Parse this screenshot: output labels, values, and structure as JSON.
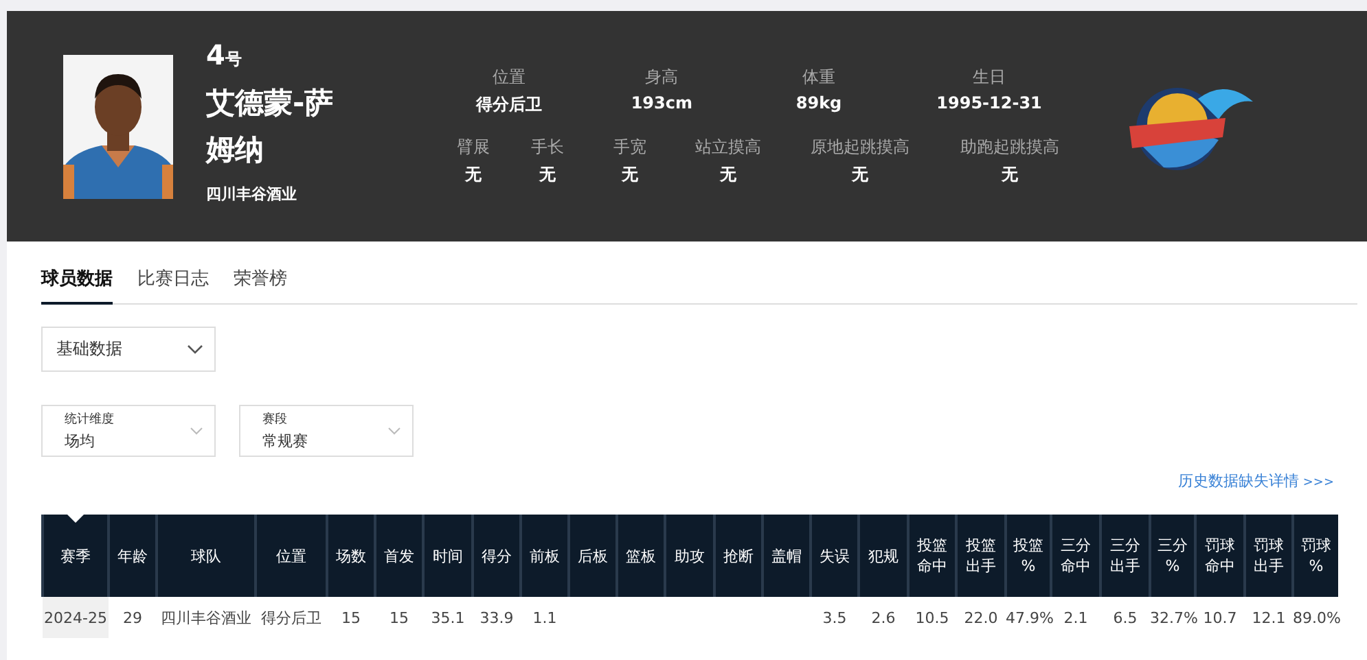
{
  "player": {
    "number": "4",
    "number_suffix": "号",
    "name": "艾德蒙-萨姆纳",
    "team": "四川丰谷酒业"
  },
  "info_rows": [
    [
      {
        "label": "位置",
        "value": "得分后卫"
      },
      {
        "label": "身高",
        "value": "193cm"
      },
      {
        "label": "体重",
        "value": "89kg"
      },
      {
        "label": "生日",
        "value": "1995-12-31"
      }
    ],
    [
      {
        "label": "臂展",
        "value": "无"
      },
      {
        "label": "手长",
        "value": "无"
      },
      {
        "label": "手宽",
        "value": "无"
      },
      {
        "label": "站立摸高",
        "value": "无"
      },
      {
        "label": "原地起跳摸高",
        "value": "无"
      },
      {
        "label": "助跑起跳摸高",
        "value": "无"
      }
    ]
  ],
  "tabs": [
    {
      "label": "球员数据",
      "selected": true
    },
    {
      "label": "比赛日志",
      "selected": false
    },
    {
      "label": "荣誉榜",
      "selected": false
    }
  ],
  "data_type_select": {
    "value": "基础数据"
  },
  "filters": [
    {
      "label": "统计维度",
      "value": "场均"
    },
    {
      "label": "赛段",
      "value": "常规赛"
    }
  ],
  "history_link": {
    "text": "历史数据缺失详情",
    "arrows": ">>>"
  },
  "table": {
    "columns": [
      {
        "label": "赛季",
        "sorted": true
      },
      {
        "label": "年龄",
        "sorted": false
      },
      {
        "label": "球队",
        "sorted": false
      },
      {
        "label": "位置",
        "sorted": false
      },
      {
        "label": "场数",
        "sorted": false
      },
      {
        "label": "首发",
        "sorted": false
      },
      {
        "label": "时间",
        "sorted": false
      },
      {
        "label": "得分",
        "sorted": false
      },
      {
        "label": "前板",
        "sorted": false
      },
      {
        "label": "后板",
        "sorted": false
      },
      {
        "label": "篮板",
        "sorted": false
      },
      {
        "label": "助攻",
        "sorted": false
      },
      {
        "label": "抢断",
        "sorted": false
      },
      {
        "label": "盖帽",
        "sorted": false
      },
      {
        "label": "失误",
        "sorted": false
      },
      {
        "label": "犯规",
        "sorted": false
      },
      {
        "label": "投篮命中",
        "sorted": false
      },
      {
        "label": "投篮出手",
        "sorted": false
      },
      {
        "label": "投篮%",
        "sorted": false
      },
      {
        "label": "三分命中",
        "sorted": false
      },
      {
        "label": "三分出手",
        "sorted": false
      },
      {
        "label": "三分%",
        "sorted": false
      },
      {
        "label": "罚球命中",
        "sorted": false
      },
      {
        "label": "罚球出手",
        "sorted": false
      },
      {
        "label": "罚球%",
        "sorted": false
      }
    ],
    "rows": [
      [
        "2024-25",
        "29",
        "四川丰谷酒业",
        "得分后卫",
        "15",
        "15",
        "35.1",
        "33.9",
        "1.1",
        null,
        null,
        null,
        null,
        null,
        "3.5",
        "2.6",
        "10.5",
        "22.0",
        "47.9%",
        "2.1",
        "6.5",
        "32.7%",
        "10.7",
        "12.1",
        "89.0%"
      ]
    ]
  }
}
